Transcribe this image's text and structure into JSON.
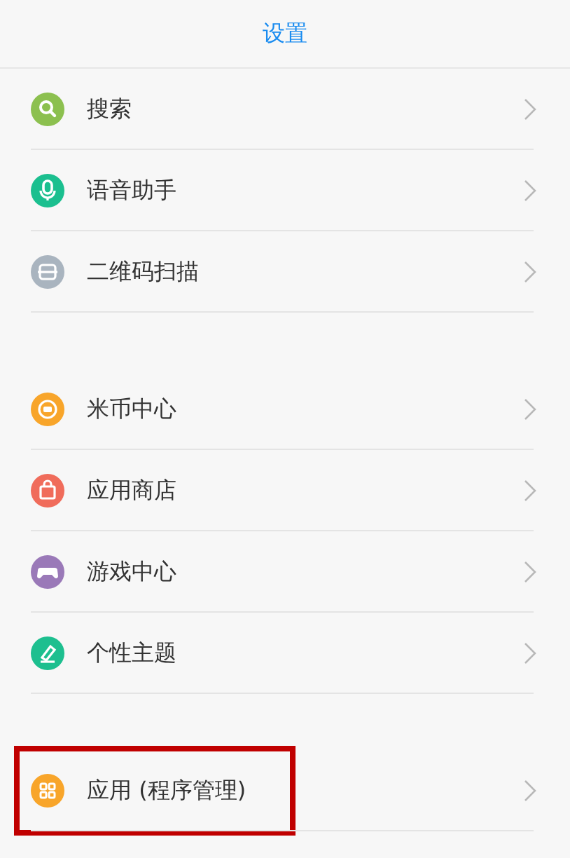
{
  "header": {
    "title": "设置"
  },
  "groups": [
    {
      "items": [
        {
          "label": "搜索",
          "kind": "search",
          "color": "#8cc04f",
          "highlighted": false
        },
        {
          "label": "语音助手",
          "kind": "mic",
          "color": "#1bbf8f",
          "highlighted": false
        },
        {
          "label": "二维码扫描",
          "kind": "scan",
          "color": "#a9b4bf",
          "highlighted": false
        }
      ]
    },
    {
      "items": [
        {
          "label": "米币中心",
          "kind": "coin",
          "color": "#f8a52a",
          "highlighted": false
        },
        {
          "label": "应用商店",
          "kind": "bag",
          "color": "#f06c5b",
          "highlighted": false
        },
        {
          "label": "游戏中心",
          "kind": "gamepad",
          "color": "#9a79b8",
          "highlighted": false
        },
        {
          "label": "个性主题",
          "kind": "brush",
          "color": "#1dbf8f",
          "highlighted": false
        }
      ]
    },
    {
      "items": [
        {
          "label": "应用 (程序管理)",
          "kind": "apps",
          "color": "#f8a52a",
          "highlighted": true
        }
      ]
    }
  ]
}
